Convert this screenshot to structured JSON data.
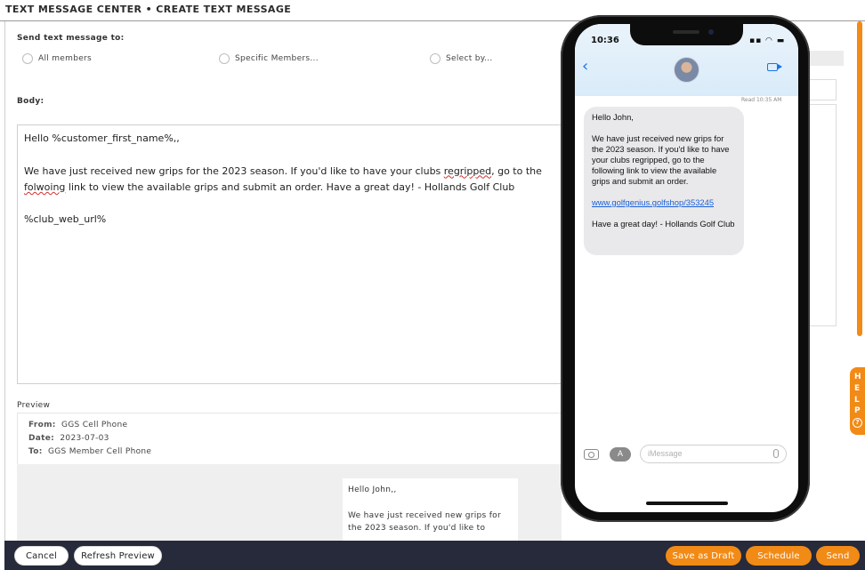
{
  "header": {
    "title": "TEXT MESSAGE CENTER • CREATE TEXT MESSAGE"
  },
  "recipients": {
    "label": "Send text message to:",
    "options": [
      "All members",
      "Specific Members...",
      "Select by..."
    ]
  },
  "body": {
    "label": "Body:",
    "line1": "Hello %customer_first_name%,,",
    "line2a": "We have just received new grips for the 2023 season. If you'd like to have your clubs ",
    "line2b": "regripped",
    "line2c": ", go to the",
    "line3a": "folwoing",
    "line3b": " link to view the available grips and submit an order. Have a great day! - Hollands Golf Club",
    "line4": "%club_web_url%"
  },
  "preview": {
    "label": "Preview",
    "from_label": "From:",
    "from_value": "GGS Cell Phone",
    "date_label": "Date:",
    "date_value": "2023-07-03",
    "to_label": "To:",
    "to_value": "GGS Member Cell Phone",
    "card_line1": "Hello John,,",
    "card_line2": "We have just received new grips for",
    "card_line3": "the 2023 season. If you'd like to"
  },
  "footer": {
    "cancel": "Cancel",
    "refresh": "Refresh Preview",
    "save_draft": "Save as Draft",
    "schedule": "Schedule",
    "send": "Send"
  },
  "help": {
    "letters": [
      "H",
      "E",
      "L",
      "P"
    ],
    "icon": "?"
  },
  "phone": {
    "time": "10:36",
    "read": "Read 10:35 AM",
    "bubble_greeting": "Hello John,",
    "bubble_body": "We have just received new grips for the 2023 season. If you'd like to have your clubs regripped, go to the following link to view the available grips and submit an order.",
    "bubble_link": "www.golfgenius.golfshop/353245",
    "bubble_closing": "Have a great day! - Hollands Golf Club",
    "input_placeholder": "iMessage"
  },
  "colors": {
    "accent": "#f28a16",
    "footer_bg": "#262a3a",
    "link": "#1a5fd6"
  }
}
